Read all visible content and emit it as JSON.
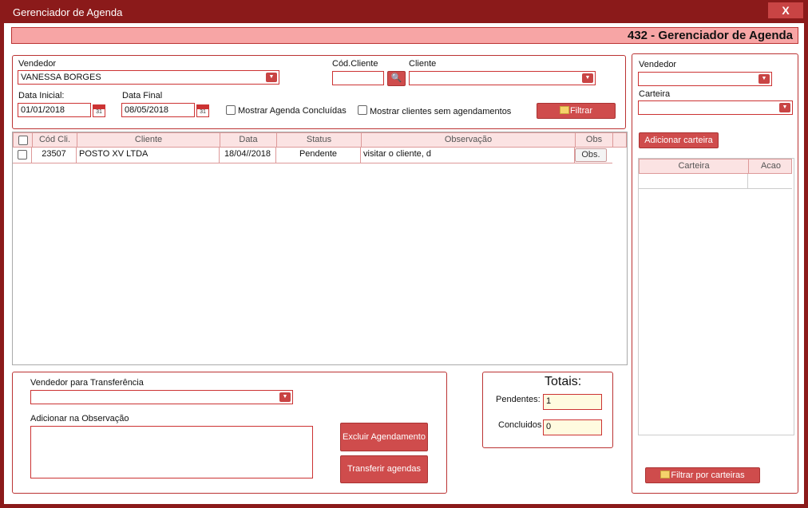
{
  "window": {
    "title": "Gerenciador de Agenda",
    "close_label": "X",
    "banner": "432 - Gerenciador de Agenda"
  },
  "filters": {
    "vendedor_label": "Vendedor",
    "vendedor_value": "VANESSA BORGES",
    "cod_cliente_label": "Cód.Cliente",
    "cod_cliente_value": "",
    "cliente_label": "Cliente",
    "cliente_value": "",
    "data_inicial_label": "Data Inicial:",
    "data_inicial_value": "01/01/2018",
    "data_final_label": "Data Final",
    "data_final_value": "08/05/2018",
    "mostrar_concluidas_label": "Mostrar Agenda Concluídas",
    "mostrar_sem_agend_label": "Mostrar clientes sem agendamentos",
    "filtrar_label": "Filtrar",
    "calendar_icon_text": "31"
  },
  "grid": {
    "columns": [
      "Cód Cli.",
      "Cliente",
      "Data",
      "Status",
      "Observação",
      "Obs"
    ],
    "rows": [
      {
        "cod": "23507",
        "cliente": "POSTO XV LTDA",
        "data": "18/04//2018",
        "status": "Pendente",
        "observacao": "visitar o cliente, d",
        "obs_button": "Obs."
      }
    ]
  },
  "transfer": {
    "vendedor_label": "Vendedor para Transferência",
    "vendedor_value": "",
    "obs_label": "Adicionar na Observação",
    "obs_value": "",
    "excluir_label": "Excluir Agendamento",
    "transferir_label": "Transferir agendas"
  },
  "totais": {
    "title": "Totais:",
    "pendentes_label": "Pendentes:",
    "pendentes_value": "1",
    "concluidos_label": "Concluidos",
    "concluidos_value": "0"
  },
  "right": {
    "vendedor_label": "Vendedor",
    "vendedor_value": "",
    "carteira_label": "Carteira",
    "carteira_value": "",
    "adicionar_label": "Adicionar carteira",
    "grid_columns": [
      "Carteira",
      "Acao"
    ],
    "filtrar_label": "Filtrar por carteiras"
  },
  "colors": {
    "frame": "#8b1a1a",
    "accent": "#cf4c4c",
    "banner": "#f7a5a5",
    "grid_header": "#fbe3e3"
  }
}
